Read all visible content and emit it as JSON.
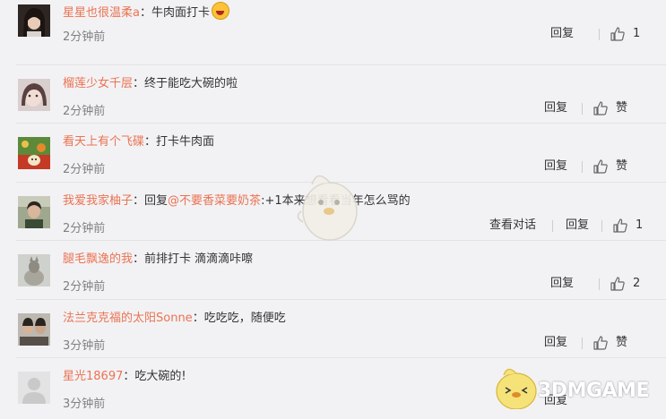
{
  "comments": [
    {
      "user": "星星也很温柔a",
      "text": "牛肉面打卡",
      "time": "2分钟前",
      "reply": "回复",
      "like": "1",
      "has_emoji": true
    },
    {
      "user": "榴莲少女千层",
      "text": "终于能吃大碗的啦",
      "time": "2分钟前",
      "reply": "回复",
      "like": "赞"
    },
    {
      "user": "看天上有个飞碟",
      "text": "打卡牛肉面",
      "time": "2分钟前",
      "reply": "回复",
      "like": "赞"
    },
    {
      "user": "我爱我家柚子",
      "text_prefix": "回复",
      "mention": "@不要香菜要奶茶",
      "text": ":+1本来想看看当年怎么骂的",
      "time": "2分钟前",
      "view_dialog": "查看对话",
      "reply": "回复",
      "like": "1"
    },
    {
      "user": "腿毛飘逸的我",
      "text": "前排打卡 滴滴滴咔嚓",
      "time": "2分钟前",
      "reply": "回复",
      "like": "2"
    },
    {
      "user": "法兰克克福的太阳Sonne",
      "text": "吃吃吃，随便吃",
      "time": "3分钟前",
      "reply": "回复",
      "like": "赞"
    },
    {
      "user": "星光18697",
      "text": "吃大碗的!",
      "time": "3分钟前",
      "reply": "回复"
    }
  ],
  "colon": "：",
  "icons": {
    "like": "thumbs-up-icon",
    "emoji": "laughing-emoji-icon",
    "mascot": "chick-mascot-icon"
  },
  "colors": {
    "username": "#eb7350",
    "background": "#f2f2f5",
    "muted": "#808080"
  },
  "watermark": "3DMGAME"
}
